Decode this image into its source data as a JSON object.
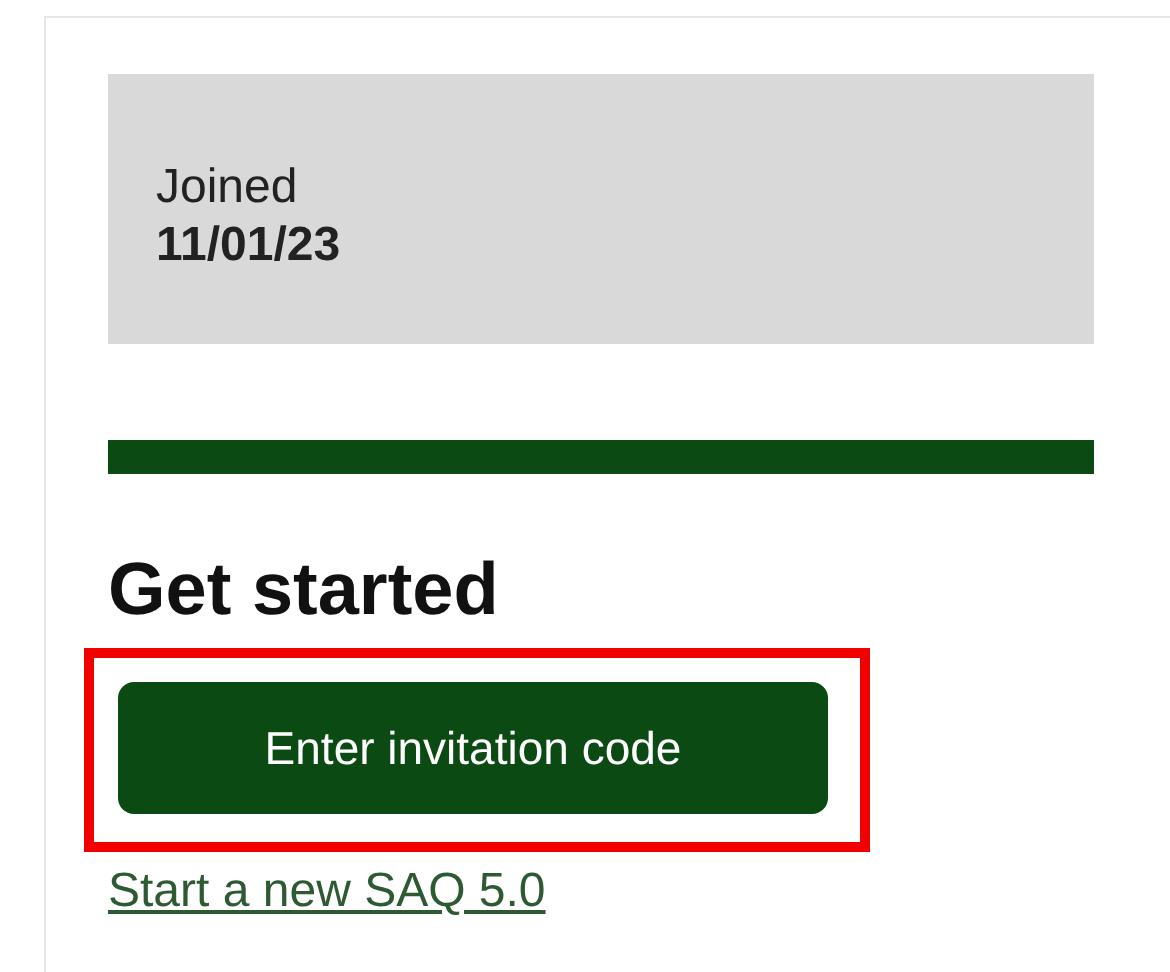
{
  "profile": {
    "label": "Joined",
    "value": "11/01/23"
  },
  "section": {
    "title": "Get started"
  },
  "primary_button": {
    "label": "Enter invitation code",
    "highlighted": true
  },
  "link": {
    "label": "Start a new SAQ 5.0"
  }
}
